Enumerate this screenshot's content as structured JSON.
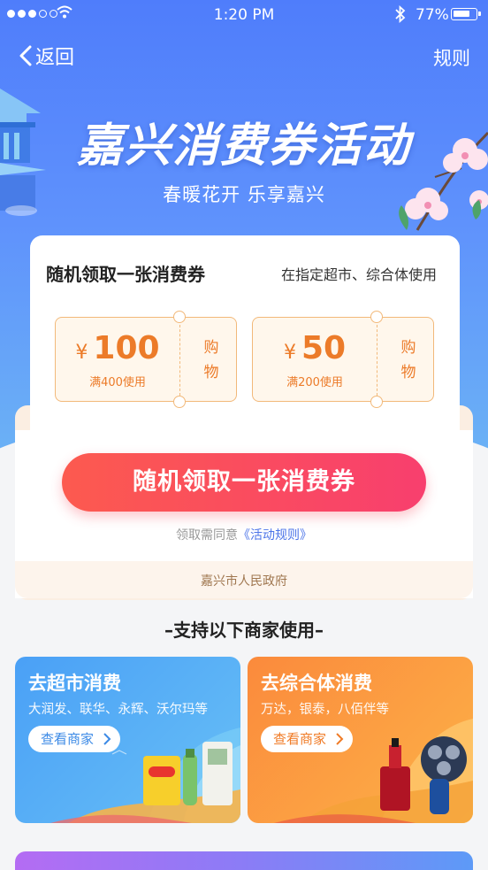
{
  "status_bar": {
    "time": "1:20 PM",
    "battery_percent": "77%",
    "battery_level": 0.77,
    "signal_bars_on": 3,
    "signal_bars_total": 5
  },
  "nav": {
    "back_label": "返回",
    "rules_label": "规则"
  },
  "hero": {
    "title": "嘉兴消费券活动",
    "subtitle": "春暖花开 乐享嘉兴"
  },
  "card": {
    "heading": "随机领取一张消费券",
    "usage_note": "在指定超市、综合体使用",
    "coupons": [
      {
        "symbol": "¥",
        "amount": "100",
        "condition": "满400使用",
        "kind": "购物"
      },
      {
        "symbol": "¥",
        "amount": "50",
        "condition": "满200使用",
        "kind": "购物"
      }
    ],
    "cta_label": "随机领取一张消费券",
    "agree_prefix": "领取需同意",
    "agree_link": "《活动规则》",
    "issuer": "嘉兴市人民政府"
  },
  "section_title": "–支持以下商家使用–",
  "merchants": [
    {
      "title": "去超市消费",
      "desc": "大润发、联华、永辉、沃尔玛等",
      "button": "查看商家"
    },
    {
      "title": "去综合体消费",
      "desc": "万达，银泰，八佰伴等",
      "button": "查看商家"
    }
  ],
  "colors": {
    "hero_top": "#4f7dfb",
    "coupon_accent": "#ec7b29",
    "cta_start": "#fc5a4f",
    "cta_end": "#f83f6e",
    "link": "#4c74e8",
    "merchant_blue": "#4aa0f6",
    "merchant_orange": "#fb8a3c"
  }
}
